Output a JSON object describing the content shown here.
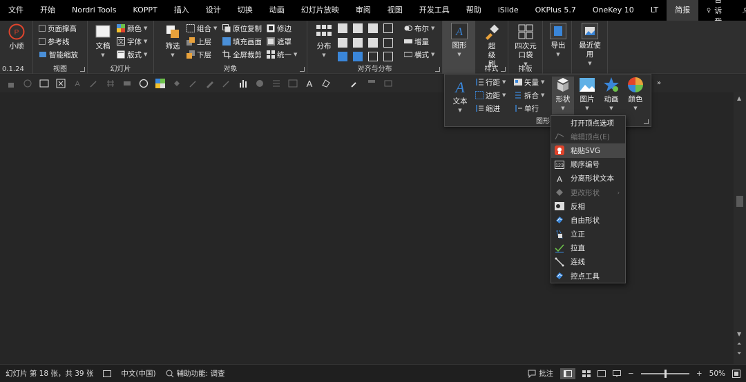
{
  "tabs": [
    "文件",
    "开始",
    "Nordri Tools",
    "KOPPT",
    "插入",
    "设计",
    "切换",
    "动画",
    "幻灯片放映",
    "审阅",
    "视图",
    "开发工具",
    "帮助",
    "iSlide",
    "OKPlus 5.7",
    "OneKey 10",
    "LT",
    "简报"
  ],
  "active_tab_index": 17,
  "tellme": "告诉我",
  "share": "共享",
  "ribbon": {
    "g_logo": {
      "btn": "小顽",
      "label": "0.1.24"
    },
    "g_view": {
      "label": "视图",
      "items": [
        "页面撑高",
        "参考线",
        "智能缩放"
      ]
    },
    "g_slide": {
      "label": "幻灯片",
      "large": "文稿",
      "items": [
        "颜色",
        "字体",
        "版式"
      ]
    },
    "g_object": {
      "label": "对象",
      "large": "筛选",
      "col1": [
        "组合",
        "上层",
        "下层"
      ],
      "col2": [
        "原位复制",
        "填充画面",
        "全屏裁剪"
      ],
      "col3": [
        "修边",
        "遮罩",
        "统一"
      ]
    },
    "g_align": {
      "label": "对齐与分布",
      "large": "分布",
      "col3": [
        "布尔",
        "增量",
        "横式"
      ]
    },
    "g_shape": {
      "large": "图形"
    },
    "g_style": {
      "label": "样式",
      "large": "超级刷"
    },
    "g_layout": {
      "label": "排版",
      "large": "四次元口袋"
    },
    "g_export": {
      "large": "导出"
    },
    "g_recent": {
      "large": "最近使用"
    }
  },
  "gallery": {
    "label": "图形",
    "text_btn": "文本",
    "col1": [
      "行距",
      "边距",
      "缩进"
    ],
    "col2": [
      "矢量",
      "拆合",
      "单行"
    ],
    "large": [
      "形状",
      "图片",
      "动画",
      "颜色"
    ]
  },
  "shape_menu": [
    {
      "label": "打开顶点选项",
      "icon": "none",
      "disabled": false
    },
    {
      "label": "编辑顶点(E)",
      "icon": "edit-points-icon",
      "disabled": true
    },
    {
      "label": "粘贴SVG",
      "icon": "paste-svg-icon",
      "disabled": false,
      "highlighted": true
    },
    {
      "label": "顺序编号",
      "icon": "numbering-icon",
      "disabled": false
    },
    {
      "label": "分离形状文本",
      "icon": "text-a-icon",
      "disabled": false
    },
    {
      "label": "更改形状",
      "icon": "change-shape-icon",
      "disabled": true,
      "submenu": true
    },
    {
      "label": "反相",
      "icon": "invert-icon",
      "disabled": false
    },
    {
      "label": "自由形状",
      "icon": "freeform-icon",
      "disabled": false
    },
    {
      "label": "立正",
      "icon": "upright-icon",
      "disabled": false
    },
    {
      "label": "拉直",
      "icon": "straighten-icon",
      "disabled": false
    },
    {
      "label": "连线",
      "icon": "connector-icon",
      "disabled": false
    },
    {
      "label": "控点工具",
      "icon": "handle-tool-icon",
      "disabled": false
    }
  ],
  "status": {
    "slide_info": "幻灯片 第 18 张，共 39 张",
    "language": "中文(中国)",
    "accessibility": "辅助功能: 调查",
    "notes": "批注",
    "zoom": "50%",
    "zoom_level": 0.5
  },
  "colors": {
    "accent_blue": "#3a86d9",
    "paste_icon_red": "#e0442c",
    "ribbon_bg": "#2f2f2f",
    "tab_bg": "#000000"
  }
}
